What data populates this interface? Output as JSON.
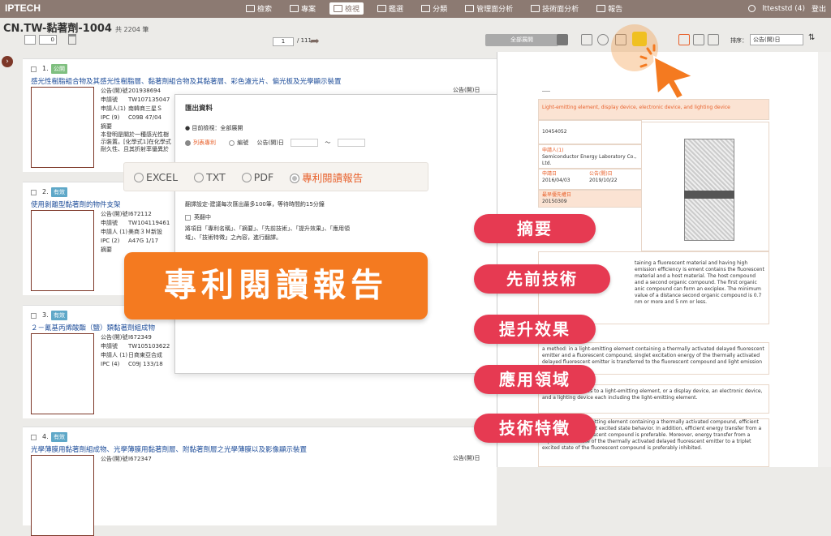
{
  "app": {
    "logo": "IPTECH",
    "user": "ltteststd (4)",
    "logout": "登出"
  },
  "nav": [
    {
      "label": "檢索",
      "active": false
    },
    {
      "label": "專案",
      "active": false
    },
    {
      "label": "檢視",
      "active": true
    },
    {
      "label": "鑑選",
      "active": false
    },
    {
      "label": "分類",
      "active": false
    },
    {
      "label": "管理面分析",
      "active": false
    },
    {
      "label": "技術面分析",
      "active": false
    },
    {
      "label": "報告",
      "active": false
    }
  ],
  "header": {
    "title": "CN.TW-黏著劑-1004",
    "count": "共 2204 筆",
    "selected": "0",
    "page": "1",
    "page_total": "/ 111",
    "view_select": "全部展開",
    "sort_label": "排序：",
    "sort_value": "公告(開)日"
  },
  "results": [
    {
      "num": "1.",
      "badge": "公開",
      "title": "感光性樹脂組合物及其感光性樹脂層、黏著劑組合物及其黏著層、彩色濾光片、偏光板及光學顯示裝置",
      "meta": [
        [
          "公告(開)號",
          "201938694"
        ],
        [
          "申請號",
          "TW107135047"
        ],
        [
          "申請人(1)",
          "南韓商三星Ｓ"
        ],
        [
          "IPC (9)",
          "C09B 47/04"
        ],
        [
          "摘要",
          ""
        ]
      ],
      "abstract": "本發明是關於一種感光性樹 示裝置。[化學式1]在化學式 耐久性、且其折射率優異於",
      "date": "公告(開)日"
    },
    {
      "num": "2.",
      "badge": "有效",
      "title": "使用剝離型黏著劑的物件支架",
      "meta": [
        [
          "公告(開)號",
          "I672112"
        ],
        [
          "申請號",
          "TW104119461"
        ],
        [
          "申請人 (1)",
          "美商３Ｍ新設"
        ],
        [
          "IPC (2)",
          "A47G 1/17"
        ],
        [
          "摘要",
          ""
        ]
      ],
      "date": ""
    },
    {
      "num": "3.",
      "badge": "有效",
      "title": "２－氰基丙烯酸酯（鹽）類黏著劑組成物",
      "meta": [
        [
          "公告(開)號",
          "I672349"
        ],
        [
          "申請號",
          "TW105103622"
        ],
        [
          "申請人 (1)",
          "日商東亞合成"
        ],
        [
          "IPC (4)",
          "C09J 133/18"
        ]
      ],
      "date": ""
    },
    {
      "num": "4.",
      "badge": "有效",
      "title": "光學薄膜用黏著劑組成物、光學薄膜用黏著劑層、附黏著劑層之光學薄膜以及影像顯示裝置",
      "meta": [
        [
          "公告(開)號",
          "I672347"
        ]
      ],
      "date": "公告(開)日"
    }
  ],
  "export": {
    "title": "匯出資料",
    "scope": "目前檢視：全部展開",
    "opt_list": "列表專利",
    "opt_num": "編號",
    "opt_date": "公告(開)日",
    "range_sep": "～",
    "formats": [
      {
        "label": "EXCEL",
        "on": false
      },
      {
        "label": "TXT",
        "on": false
      },
      {
        "label": "PDF",
        "on": false
      },
      {
        "label": "專利閱讀報告",
        "on": true
      }
    ],
    "note": "翻譯設定-建議每次匯出最多100筆，等待時間約15分鐘",
    "translate": "英翻中",
    "translate_desc": "將項目「專利名稱」、「摘要」、「先前技術」、「提升效果」、「應用領域」、「技術特徵」之內容，進行翻譯。"
  },
  "banner": "專利閱讀報告",
  "pills": [
    "摘要",
    "先前技術",
    "提升效果",
    "應用領域",
    "技術特徵"
  ],
  "doc": {
    "title": "Light-emitting element, display device, electronic device, and lighting device",
    "pubno": "10454052",
    "applicant_label": "申請人(1)",
    "applicant": "Semiconductor Energy Laboratory Co., Ltd.",
    "filing_label": "申請日",
    "filing": "2016/04/03",
    "pub_label": "公告(開)日",
    "pub": "2019/10/22",
    "priority_label": "最早優先權日",
    "priority": "20150309",
    "p1": "taining a fluorescent material and having high emission efficiency is ement contains the fluorescent material and a host material. The host compound and a second organic compound. The first organic anic compound can form an exciplex. The minimum value of a distance second organic compound is 0.7 nm or more and 5 nm or less.",
    "p2": "a method: in a light-emitting element containing a thermally activated delayed fluorescent emitter and a fluorescent compound, singlet excitation energy of the thermally activated delayed fluorescent emitter is transferred to the fluorescent compound and light emission is compound.",
    "p3": "ent invention relates to a light-emitting element, or a display device, an electronic device, and a lighting device each including the light-emitting element.",
    "p4": "ficiency of a light-emitting element containing a thermally activated compound, efficient generation of a singlet excited state behavior. In addition, efficient energy transfer from a singlet excited fluorescent compound is preferable. Moreover, energy transfer from a triplet excited state of the thermally activated delayed fluorescent emitter to a triplet excited state of the fluorescent compound is preferably inhibited."
  }
}
